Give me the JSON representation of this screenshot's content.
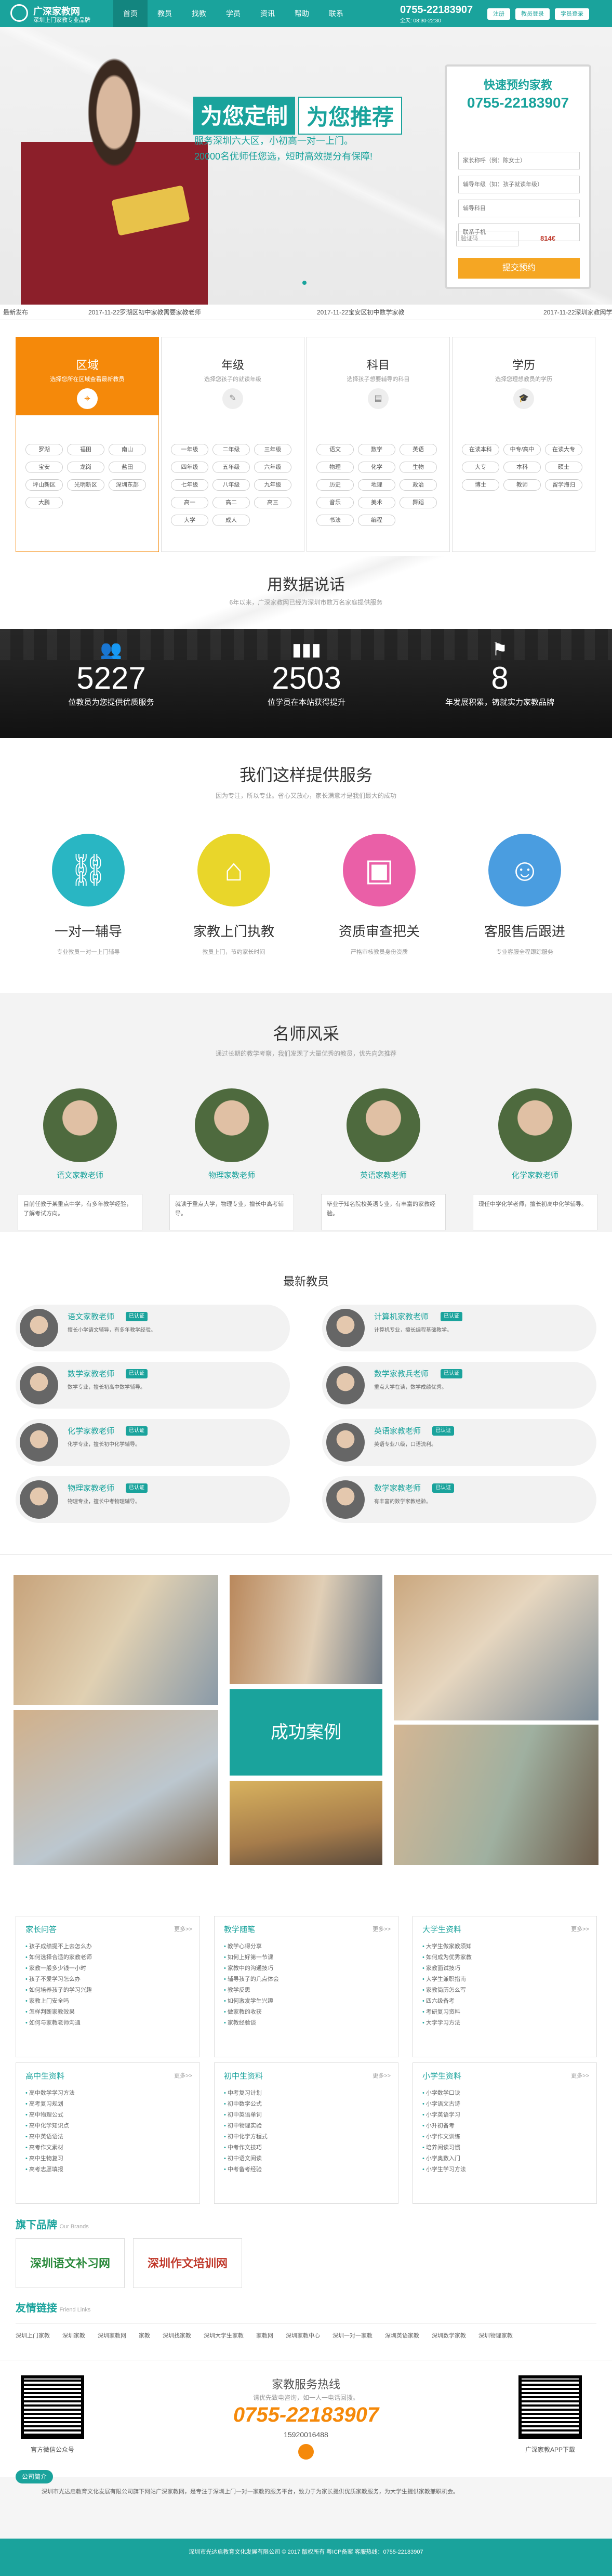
{
  "header": {
    "logo_title": "广深家教网",
    "logo_sub": "深圳上门家教专业品牌",
    "nav": [
      "首页",
      "教员",
      "找教",
      "学员",
      "资讯",
      "帮助",
      "联系"
    ],
    "phone": "0755-22183907",
    "hours": "全天: 08:30-22:30",
    "btn_register": "注册",
    "btn_teacher_login": "教员登录",
    "btn_student_login": "学员登录"
  },
  "hero": {
    "title_a": "为您定制",
    "title_b": "为您推荐",
    "line1": "服务深圳六大区，小初高一对一上门。",
    "line2": "20000名优师任您选，短时高效提分有保障!",
    "form_title": "快速预约家教",
    "form_phone": "0755-22183907",
    "ph_name": "家长称呼（例：陈女士）",
    "ph_grade": "辅导年级（如：孩子就读年级）",
    "ph_subject": "辅导科目",
    "ph_phone": "联系手机",
    "ph_code": "验证码",
    "code": "814€",
    "submit": "提交预约"
  },
  "ticker": [
    "最新发布",
    "2017-11-22罗湖区初中家教需要家教老师",
    "2017-11-22宝安区初中数学家教",
    "2017-11-22深圳家教网学员"
  ],
  "categories": [
    {
      "title": "区域",
      "sub": "选择您所在区域查看最新教员",
      "items": [
        "罗湖",
        "福田",
        "南山",
        "宝安",
        "龙岗",
        "盐田",
        "坪山新区",
        "光明新区",
        "深圳东部",
        "大鹏"
      ]
    },
    {
      "title": "年级",
      "sub": "选择您孩子的就读年级",
      "items": [
        "一年级",
        "二年级",
        "三年级",
        "四年级",
        "五年级",
        "六年级",
        "七年级",
        "八年级",
        "九年级",
        "高一",
        "高二",
        "高三",
        "大学",
        "成人"
      ]
    },
    {
      "title": "科目",
      "sub": "选择孩子想要辅导的科目",
      "items": [
        "语文",
        "数学",
        "英语",
        "物理",
        "化学",
        "生物",
        "历史",
        "地理",
        "政治",
        "音乐",
        "美术",
        "舞蹈",
        "书法",
        "编程"
      ]
    },
    {
      "title": "学历",
      "sub": "选择您理想教员的学历",
      "items": [
        "在读本科",
        "中专/高中",
        "在读大专",
        "大专",
        "本科",
        "硕士",
        "博士",
        "教师",
        "留学海归"
      ]
    }
  ],
  "data_section": {
    "title": "用数据说话",
    "sub": "6年以来，广深家教网已经为深圳市数万名家庭提供服务",
    "stats": [
      {
        "num": "5227",
        "label": "位教员为您提供优质服务"
      },
      {
        "num": "2503",
        "label": "位学员在本站获得提升"
      },
      {
        "num": "8",
        "label": "年发展积累，铸就实力家教品牌"
      }
    ]
  },
  "services": {
    "title": "我们这样提供服务",
    "sub": "因为专注，所以专业。省心又放心，家长满意才是我们最大的成功",
    "items": [
      {
        "title": "一对一辅导",
        "desc": "专业教员一对一上门辅导"
      },
      {
        "title": "家教上门执教",
        "desc": "教员上门，节约家长时间"
      },
      {
        "title": "资质审查把关",
        "desc": "严格审核教员身份资质"
      },
      {
        "title": "客服售后跟进",
        "desc": "专业客服全程跟踪服务"
      }
    ]
  },
  "famous": {
    "title": "名师风采",
    "sub": "通过长期的教学考察，我们发现了大量优秀的教员，优先向您推荐",
    "items": [
      {
        "name": "语文家教老师",
        "desc": "目前任教于某重点中学，有多年教学经验，了解考试方向。"
      },
      {
        "name": "物理家教老师",
        "desc": "就读于重点大学，物理专业，擅长中高考辅导。"
      },
      {
        "name": "英语家教老师",
        "desc": "毕业于知名院校英语专业，有丰富的家教经验。"
      },
      {
        "name": "化学家教老师",
        "desc": "现任中学化学老师，擅长初高中化学辅导。"
      }
    ]
  },
  "new_teachers": {
    "title": "最新教员",
    "items": [
      {
        "name": "语文家教老师",
        "badge": "已认证",
        "desc": "擅长小学语文辅导，有多年教学经验。"
      },
      {
        "name": "计算机家教老师",
        "badge": "已认证",
        "desc": "计算机专业，擅长编程基础教学。"
      },
      {
        "name": "数学家教老师",
        "badge": "已认证",
        "desc": "数学专业，擅长初高中数学辅导。"
      },
      {
        "name": "数学家教兵老师",
        "badge": "已认证",
        "desc": "重点大学在读，数学成绩优秀。"
      },
      {
        "name": "化学家教老师",
        "badge": "已认证",
        "desc": "化学专业，擅长初中化学辅导。"
      },
      {
        "name": "英语家教老师",
        "badge": "已认证",
        "desc": "英语专业八级，口语流利。"
      },
      {
        "name": "物理家教老师",
        "badge": "已认证",
        "desc": "物理专业，擅长中考物理辅导。"
      },
      {
        "name": "数学家教老师",
        "badge": "已认证",
        "desc": "有丰富的数学家教经验。"
      }
    ]
  },
  "cases": {
    "label": "成功案例"
  },
  "resources": [
    {
      "title": "家长问答",
      "more": "更多>>",
      "items": [
        "孩子成绩提不上去怎么办",
        "如何选择合适的家教老师",
        "家教一般多少钱一小时",
        "孩子不爱学习怎么办",
        "如何培养孩子的学习兴趣",
        "家教上门安全吗",
        "怎样判断家教效果",
        "如何与家教老师沟通"
      ]
    },
    {
      "title": "教学随笔",
      "more": "更多>>",
      "items": [
        "教学心得分享",
        "如何上好第一节课",
        "家教中的沟通技巧",
        "辅导孩子的几点体会",
        "教学反思",
        "如何激发学生兴趣",
        "做家教的收获",
        "家教经验谈"
      ]
    },
    {
      "title": "大学生资料",
      "more": "更多>>",
      "items": [
        "大学生做家教须知",
        "如何成为优秀家教",
        "家教面试技巧",
        "大学生兼职指南",
        "家教简历怎么写",
        "四六级备考",
        "考研复习资料",
        "大学学习方法"
      ]
    },
    {
      "title": "高中生资料",
      "more": "更多>>",
      "items": [
        "高中数学学习方法",
        "高考复习规划",
        "高中物理公式",
        "高中化学知识点",
        "高中英语语法",
        "高考作文素材",
        "高中生物复习",
        "高考志愿填报"
      ]
    },
    {
      "title": "初中生资料",
      "more": "更多>>",
      "items": [
        "中考复习计划",
        "初中数学公式",
        "初中英语单词",
        "初中物理实验",
        "初中化学方程式",
        "中考作文技巧",
        "初中语文阅读",
        "中考备考经验"
      ]
    },
    {
      "title": "小学生资料",
      "more": "更多>>",
      "items": [
        "小学数学口诀",
        "小学语文古诗",
        "小学英语学习",
        "小升初备考",
        "小学作文训练",
        "培养阅读习惯",
        "小学奥数入门",
        "小学生学习方法"
      ]
    }
  ],
  "brands": {
    "title": "旗下品牌",
    "sub": "Our Brands",
    "items": [
      "深圳语文补习网",
      "深圳作文培训网"
    ]
  },
  "links": {
    "title": "友情链接",
    "sub": "Friend Links",
    "items": [
      "深圳上门家教",
      "深圳家教",
      "深圳家教网",
      "家教",
      "深圳找家教",
      "深圳大学生家教",
      "家教网",
      "深圳家教中心",
      "深圳一对一家教",
      "深圳英语家教",
      "深圳数学家教",
      "深圳物理家教"
    ]
  },
  "footer": {
    "hot_title": "家教服务热线",
    "hot_sub": "请优先致电咨询，如一人一电话回拨。",
    "hot_phone": "0755-22183907",
    "hot_mobile": "15920016488",
    "qr_left": "官方微信公众号",
    "qr_right": "广深家教APP下载",
    "company_tag": "公司简介",
    "desc": "深圳市光达启教育文化发展有限公司旗下网站广深家教网，是专注于深圳上门一对一家教的服务平台，致力于为家长提供优质家教服务，为大学生提供家教兼职机会。",
    "copyright": "深圳市光达启教育文化发展有限公司 © 2017 版权所有 粤ICP备案 客服热线：0755-22183907"
  },
  "colors": {
    "primary": "#1aa39c",
    "accent": "#f5a623",
    "orange": "#f5890a"
  }
}
